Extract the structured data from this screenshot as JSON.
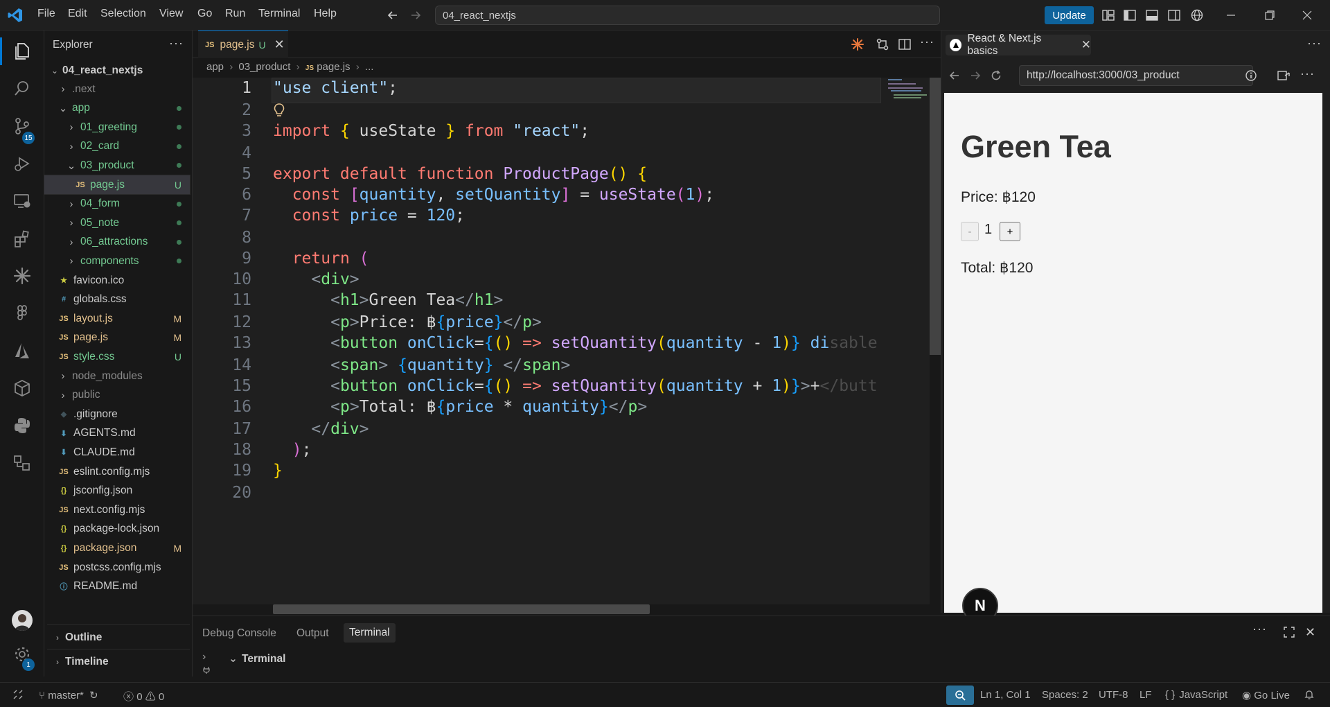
{
  "titlebar": {
    "menu": [
      "File",
      "Edit",
      "Selection",
      "View",
      "Go",
      "Run",
      "Terminal",
      "Help"
    ],
    "command_center": "04_react_nextjs",
    "update_label": "Update"
  },
  "activity": {
    "scm_badge": "15",
    "settings_badge": "1"
  },
  "sidebar": {
    "title": "Explorer",
    "root": "04_react_nextjs",
    "items": [
      {
        "label": ".next",
        "kind": "folder-closed"
      },
      {
        "label": "app",
        "kind": "folder-open"
      },
      {
        "label": "01_greeting",
        "kind": "folder-closed"
      },
      {
        "label": "02_card",
        "kind": "folder-closed"
      },
      {
        "label": "03_product",
        "kind": "folder-open"
      },
      {
        "label": "page.js",
        "kind": "js",
        "status": "U"
      },
      {
        "label": "04_form",
        "kind": "folder-closed"
      },
      {
        "label": "05_note",
        "kind": "folder-closed"
      },
      {
        "label": "06_attractions",
        "kind": "folder-closed"
      },
      {
        "label": "components",
        "kind": "folder-closed"
      },
      {
        "label": "favicon.ico",
        "kind": "star"
      },
      {
        "label": "globals.css",
        "kind": "css"
      },
      {
        "label": "layout.js",
        "kind": "js",
        "status": "M"
      },
      {
        "label": "page.js",
        "kind": "js",
        "status": "M"
      },
      {
        "label": "style.css",
        "kind": "js",
        "status": "U"
      },
      {
        "label": "node_modules",
        "kind": "folder-closed"
      },
      {
        "label": "public",
        "kind": "folder-closed"
      },
      {
        "label": ".gitignore",
        "kind": "git"
      },
      {
        "label": "AGENTS.md",
        "kind": "md"
      },
      {
        "label": "CLAUDE.md",
        "kind": "md"
      },
      {
        "label": "eslint.config.mjs",
        "kind": "js"
      },
      {
        "label": "jsconfig.json",
        "kind": "json"
      },
      {
        "label": "next.config.mjs",
        "kind": "js"
      },
      {
        "label": "package-lock.json",
        "kind": "json"
      },
      {
        "label": "package.json",
        "kind": "json",
        "status": "M"
      },
      {
        "label": "postcss.config.mjs",
        "kind": "js"
      },
      {
        "label": "README.md",
        "kind": "info"
      }
    ],
    "outline": "Outline",
    "timeline": "Timeline"
  },
  "editor": {
    "tab_label": "page.js",
    "tab_status": "U",
    "breadcrumb": [
      "app",
      "03_product",
      "page.js",
      "..."
    ],
    "line_numbers": [
      "1",
      "2",
      "3",
      "4",
      "5",
      "6",
      "7",
      "8",
      "9",
      "10",
      "11",
      "12",
      "13",
      "14",
      "15",
      "16",
      "17",
      "18",
      "19",
      "20"
    ]
  },
  "browser": {
    "tab_title": "React & Next.js basics",
    "url": "http://localhost:3000/03_product",
    "page": {
      "heading": "Green Tea",
      "price": "Price: ฿120",
      "minus": "-",
      "quantity": "1",
      "plus": "+",
      "total": "Total: ฿120",
      "next_badge": "N"
    }
  },
  "panel": {
    "tabs": [
      "Debug Console",
      "Output",
      "Terminal"
    ],
    "section": "Terminal"
  },
  "statusbar": {
    "branch": "master*",
    "errors": "0",
    "warnings": "0",
    "position": "Ln 1, Col 1",
    "spaces": "Spaces: 2",
    "encoding": "UTF-8",
    "eol": "LF",
    "language": "JavaScript",
    "golive": "Go Live"
  },
  "colors": {
    "accent": "#0078d4",
    "button": "#0e639c",
    "untracked": "#73c991",
    "modified": "#e2c08d"
  }
}
